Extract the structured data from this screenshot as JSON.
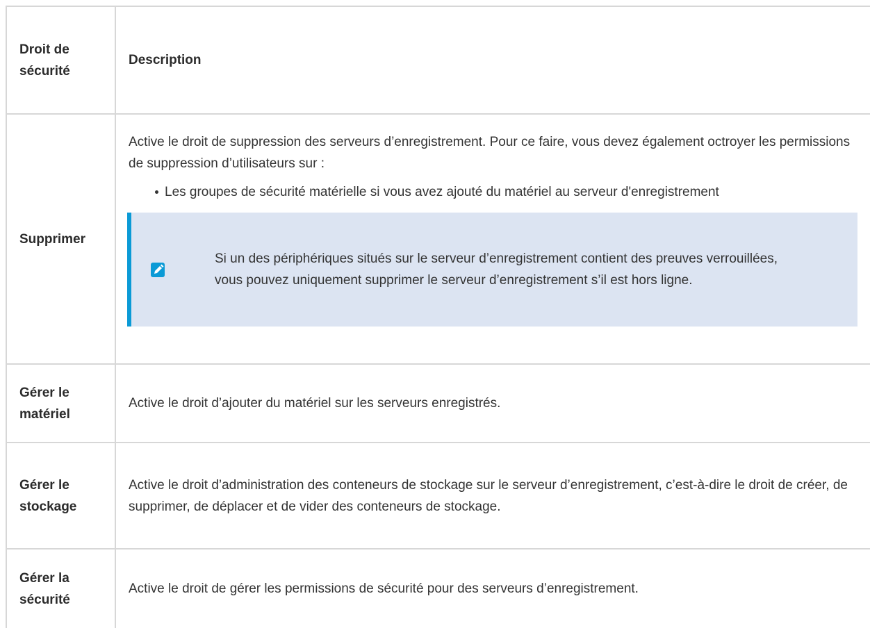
{
  "table": {
    "header": {
      "col1": "Droit de sécurité",
      "col2": "Description"
    },
    "rows": [
      {
        "name": "Supprimer",
        "description": "Active le droit de suppression des serveurs d’enregistrement. Pour ce faire, vous devez également octroyer les permissions de suppression d’utilisateurs sur :",
        "bullets": [
          "Les groupes de sécurité matérielle si vous avez ajouté du matériel au serveur d'enregistrement"
        ],
        "note": {
          "icon": "pencil-icon",
          "text": "Si un des périphériques situés sur le serveur d’enregistrement contient des preuves verrouillées, vous pouvez uniquement supprimer le serveur d’enregistrement s’il est hors ligne."
        }
      },
      {
        "name": "Gérer le matériel",
        "description": "Active le droit d’ajouter du matériel sur les serveurs enregistrés."
      },
      {
        "name": "Gérer le stockage",
        "description": "Active le droit d’administration des conteneurs de stockage sur le serveur d’enregistrement, c’est-à-dire le droit de créer, de supprimer, de déplacer et de vider des conteneurs de stockage."
      },
      {
        "name": "Gérer la sécurité",
        "description": "Active le droit de gérer les permissions de sécurité pour des serveurs d’enregistrement."
      }
    ]
  },
  "colors": {
    "border": "#d7d7d7",
    "note_background": "#dce4f2",
    "note_accent": "#0b9ad6"
  }
}
